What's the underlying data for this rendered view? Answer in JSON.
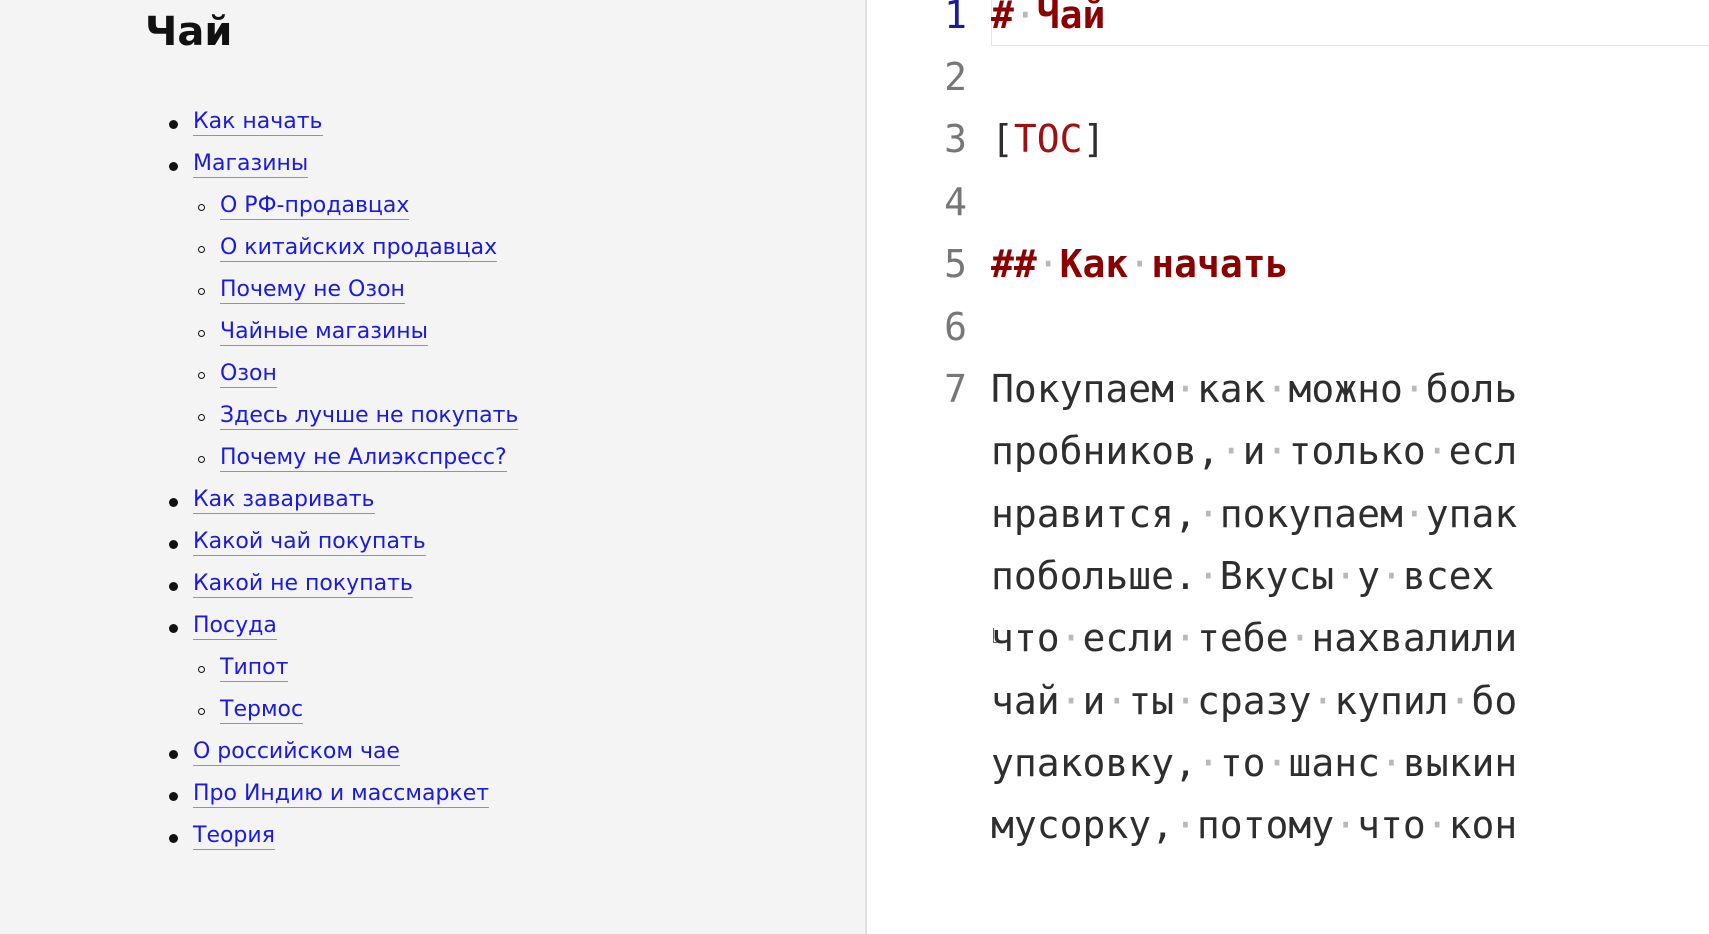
{
  "preview": {
    "title": "Чай",
    "toc": [
      {
        "label": "Как начать",
        "level": 1
      },
      {
        "label": "Магазины",
        "level": 1
      },
      {
        "label": "О РФ-продавцах",
        "level": 2
      },
      {
        "label": "О китайских продавцах",
        "level": 2
      },
      {
        "label": "Почему не Озон",
        "level": 2
      },
      {
        "label": "Чайные магазины",
        "level": 2
      },
      {
        "label": "Озон",
        "level": 2
      },
      {
        "label": "Здесь лучше не покупать",
        "level": 2
      },
      {
        "label": "Почему не Алиэкспресс?",
        "level": 2
      },
      {
        "label": "Как заваривать",
        "level": 1
      },
      {
        "label": "Какой чай покупать",
        "level": 1
      },
      {
        "label": "Какой не покупать",
        "level": 1
      },
      {
        "label": "Посуда",
        "level": 1
      },
      {
        "label": "Типот",
        "level": 2
      },
      {
        "label": "Термос",
        "level": 2
      },
      {
        "label": "О российском чае",
        "level": 1
      },
      {
        "label": "Про Индию и массмаркет",
        "level": 1
      },
      {
        "label": "Теория",
        "level": 1
      }
    ]
  },
  "editor": {
    "line_numbers": [
      "1",
      "2",
      "3",
      "4",
      "5",
      "6",
      "7"
    ],
    "line1": {
      "marker": "#",
      "text": "Чай"
    },
    "line3": {
      "open": "[",
      "keyword": "TOC",
      "close": "]"
    },
    "line5": {
      "marker": "##",
      "word1": "Как",
      "word2": "начать"
    },
    "paragraph_lines": [
      "Покупаем как можно боль",
      "пробников, и только есл",
      "нравится, покупаем упак",
      "побольше. Вкусы у всех",
      "что если тебе нахвалили",
      "чай и ты сразу купил бо",
      "упаковку, то шанс выкин",
      "мусорку, потому что кон"
    ]
  },
  "colors": {
    "link": "#1a1ae0",
    "heading_markdown": "#8b0000",
    "whitespace_dot": "#b9b9b9",
    "active_line_number": "#1a1a9a"
  }
}
